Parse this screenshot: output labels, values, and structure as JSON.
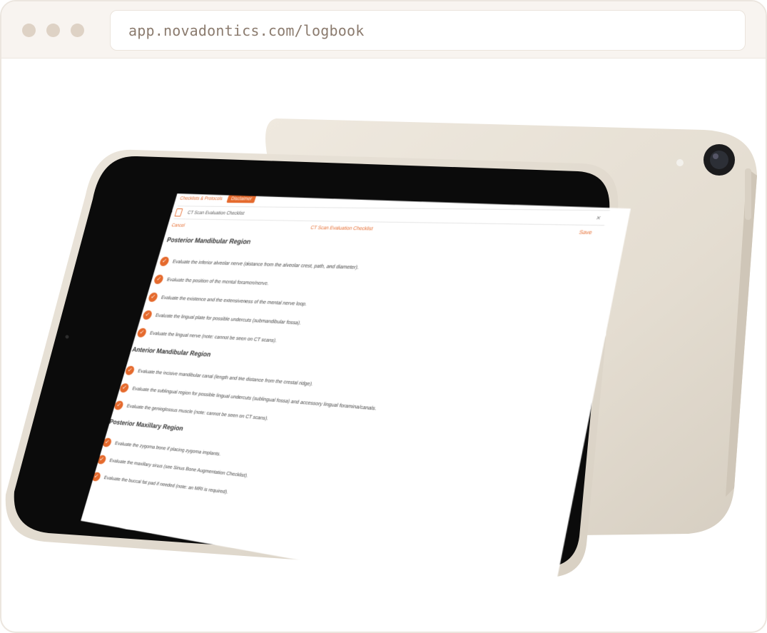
{
  "browser": {
    "url": "app.novadontics.com/logbook"
  },
  "app": {
    "tabs": [
      "Checklists & Protocols",
      "Disclaimer"
    ],
    "document_name": "CT Scan Evaluation Checklist",
    "close_label": "×",
    "cancel_label": "Cancel",
    "form_title": "CT Scan Evaluation Checklist",
    "save_label": "Save"
  },
  "sections": [
    {
      "title": "Posterior Mandibular Region",
      "items": [
        "Evaluate the inferior alveolar nerve (distance from the alveolar crest, path, and diameter).",
        "Evaluate the position of the mental foramen/nerve.",
        "Evaluate the existence and the extensiveness of the mental nerve loop.",
        "Evaluate the lingual plate for possible undercuts (submandibular fossa).",
        "Evaluate the lingual nerve (note: cannot be seen on CT scans)."
      ]
    },
    {
      "title": "Anterior Mandibular Region",
      "items": [
        "Evaluate the incisive mandibular canal (length and the distance from the crestal ridge).",
        "Evaluate the sublingual region for possible lingual undercuts (sublingual fossa) and accessory lingual foramina/canals.",
        "Evaluate the genioglossus muscle (note: cannot be seen on CT scans)."
      ]
    },
    {
      "title": "Posterior Maxillary Region",
      "items": [
        "Evaluate the zygoma bone if placing zygoma implants.",
        "Evaluate the maxillary sinus (see Sinus Bone Augmentation Checklist).",
        "Evaluate the buccal fat pad if needed (note: an MRI is required)."
      ]
    }
  ],
  "colors": {
    "accent": "#e56a2d",
    "device_body": "#e6dfd3",
    "bezel": "#0b0b0b"
  },
  "icons": {
    "check": "✓"
  }
}
